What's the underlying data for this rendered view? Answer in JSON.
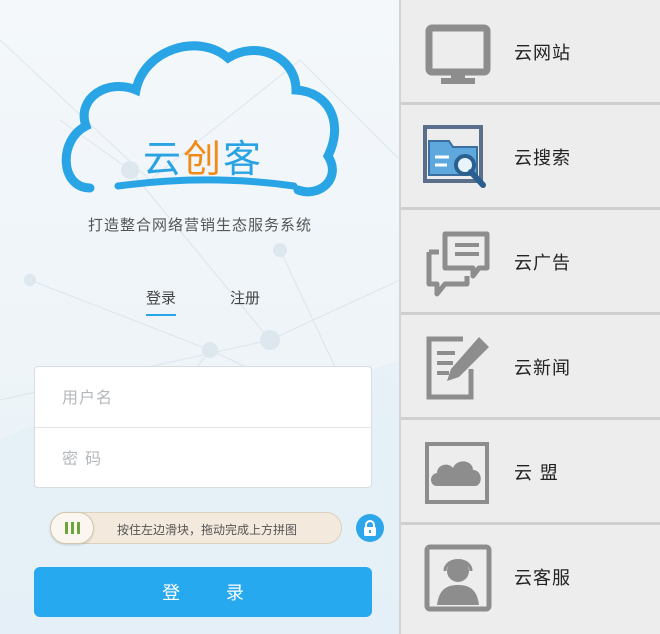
{
  "brand": {
    "logo_prefix": "云",
    "logo_accent": "创",
    "logo_suffix": "客",
    "slogan": "打造整合网络营销生态服务系统"
  },
  "tabs": {
    "login": "登录",
    "register": "注册"
  },
  "form": {
    "username_placeholder": "用户名",
    "password_placeholder": "密 码"
  },
  "captcha": {
    "instruction": "按住左边滑块，拖动完成上方拼图"
  },
  "submit_label": "登 录",
  "colors": {
    "accent": "#27a9ef",
    "logo_orange": "#f28a1a",
    "menu_bg": "#ededed",
    "icon_gray": "#8d8d8d"
  },
  "menu": {
    "items": [
      {
        "label": "云网站",
        "icon": "monitor-icon"
      },
      {
        "label": "云搜索",
        "icon": "folder-search-icon"
      },
      {
        "label": "云广告",
        "icon": "chat-bubbles-icon"
      },
      {
        "label": "云新闻",
        "icon": "edit-document-icon"
      },
      {
        "label": "云 盟",
        "icon": "cloud-icon"
      },
      {
        "label": "云客服",
        "icon": "customer-service-icon"
      }
    ]
  }
}
